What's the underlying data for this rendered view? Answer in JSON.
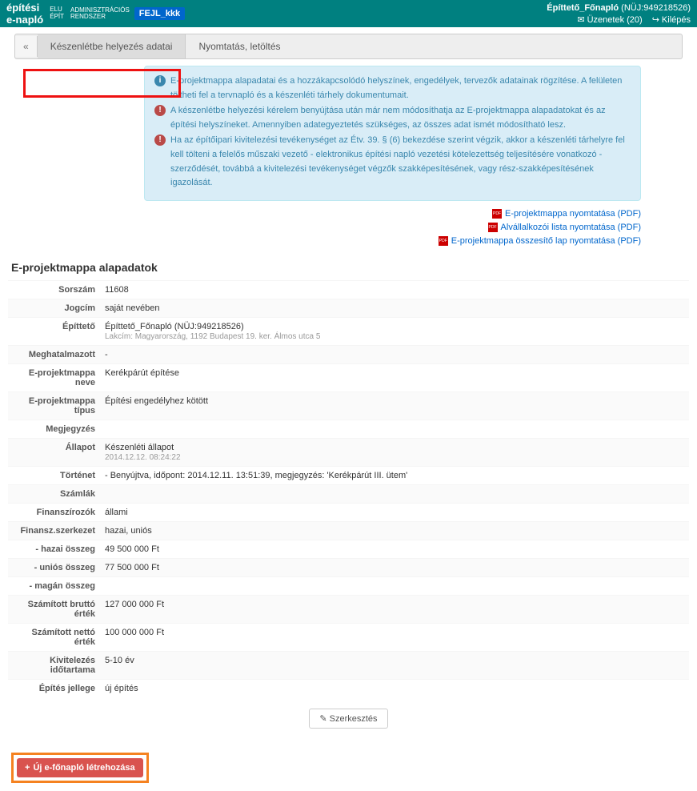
{
  "header": {
    "logo_top": "építési",
    "logo_bottom": "e-napló",
    "elu": "ELU\nÉPÍT",
    "admin": "ADMINISZTRÁCIÓS\nRENDSZER",
    "fejl": "FEJL_kkk",
    "user": "Építtető_Főnapló",
    "nuj": "(NÜJ:949218526)",
    "messages": "Üzenetek (20)",
    "logout": "Kilépés"
  },
  "tabs": {
    "collapse": "«",
    "t1": "Készenlétbe helyezés adatai",
    "t2": "Nyomtatás, letöltés"
  },
  "info": {
    "line1": "E-projektmappa alapadatai és a hozzákapcsolódó helyszínek, engedélyek, tervezők adatainak rögzítése. A felületen töltheti fel a tervnapló és a készenléti tárhely dokumentumait.",
    "line2": "A készenlétbe helyezési kérelem benyújtása után már nem módosíthatja az E-projektmappa alapadatokat és az építési helyszíneket. Amennyiben adategyeztetés szükséges, az összes adat ismét módosítható lesz.",
    "line3": "Ha az építőipari kivitelezési tevékenységet az Étv. 39. § (6) bekezdése szerint végzik, akkor a készenléti tárhelyre fel kell tölteni a felelős műszaki vezető - elektronikus építési napló vezetési kötelezettség teljesítésére vonatkozó - szerződését, továbbá a kivitelezési tevékenységet végzők szakképesítésének, vagy rész-szakképesítésének igazolását."
  },
  "printlinks": {
    "p1": "E-projektmappa nyomtatása (PDF)",
    "p2": "Alvállalkozói lista nyomtatása (PDF)",
    "p3": "E-projektmappa összesítő lap nyomtatása (PDF)"
  },
  "section_title": "E-projektmappa alapadatok",
  "rows": {
    "sorszam_l": "Sorszám",
    "sorszam_v": "11608",
    "jogcim_l": "Jogcím",
    "jogcim_v": "saját nevében",
    "epitteto_l": "Építtető",
    "epitteto_v": "Építtető_Főnapló (NÜJ:949218526)",
    "epitteto_sub": "Lakcím: Magyarország, 1192 Budapest 19. ker. Álmos utca 5",
    "meghat_l": "Meghatalmazott",
    "meghat_v": "-",
    "neve_l": "E-projektmappa neve",
    "neve_v": "Kerékpárút építése",
    "tipus_l": "E-projektmappa típus",
    "tipus_v": "Építési engedélyhez kötött",
    "megj_l": "Megjegyzés",
    "megj_v": "",
    "allapot_l": "Állapot",
    "allapot_v": "Készenléti állapot",
    "allapot_sub": "2014.12.12. 08:24:22",
    "tortenet_l": "Történet",
    "tortenet_pre": "- Benyújtva, időpont: 2014.12.11. 13:51:39, megjegyzés: ",
    "tortenet_em": "'Kerékpárút III. ütem'",
    "szamlak_l": "Számlák",
    "szamlak_v": "",
    "finansz_l": "Finanszírozók",
    "finansz_v": "állami",
    "fszerk_l": "Finansz.szerkezet",
    "fszerk_v": "hazai, uniós",
    "hazai_l": "- hazai összeg",
    "hazai_v": "49 500 000 Ft",
    "unios_l": "- uniós összeg",
    "unios_v": "77 500 000 Ft",
    "magan_l": "- magán összeg",
    "magan_v": "",
    "brutto_l": "Számított bruttó érték",
    "brutto_v": "127 000 000 Ft",
    "netto_l": "Számított nettó érték",
    "netto_v": "100 000 000 Ft",
    "kivit_l": "Kivitelezés időtartama",
    "kivit_v": "5-10 év",
    "jelleg_l": "Építés jellege",
    "jelleg_v": "új építés"
  },
  "buttons": {
    "edit": "Szerkesztés",
    "create": "Új e-főnapló létrehozása"
  }
}
